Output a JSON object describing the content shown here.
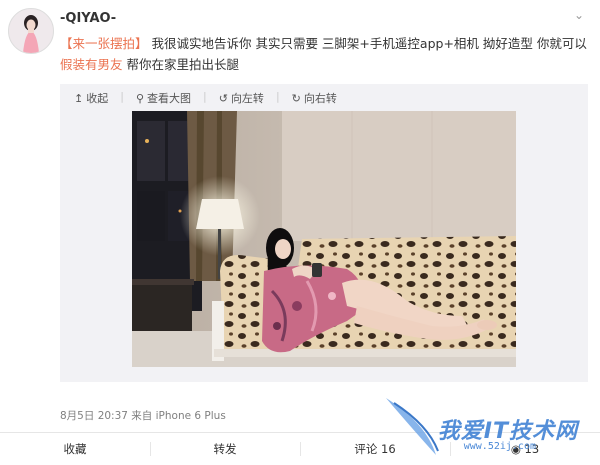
{
  "user": {
    "name": "-QIYAO-"
  },
  "post": {
    "hashtag": "【来一张摆拍】",
    "text_main": " 我很诚实地告诉你 其实只需要 三脚架+手机遥控app+相机 拗好造型 你就可以",
    "text_highlight": "假装有男友",
    "text_end": " 帮你在家里拍出长腿"
  },
  "media_toolbar": {
    "collapse": "收起",
    "view_large": "查看大图",
    "rotate_left": "向左转",
    "rotate_right": "向右转"
  },
  "meta": {
    "timestamp": "8月5日 20:37 来自 iPhone 6 Plus"
  },
  "footer": {
    "favorite": "收藏",
    "repost": "转发",
    "comment": "评论 16",
    "like": "13"
  },
  "watermark": {
    "text": "我爱IT技术网",
    "sub": "www.52ij.com"
  },
  "colors": {
    "link": "#eb7350",
    "watermark": "#4a88d6"
  }
}
